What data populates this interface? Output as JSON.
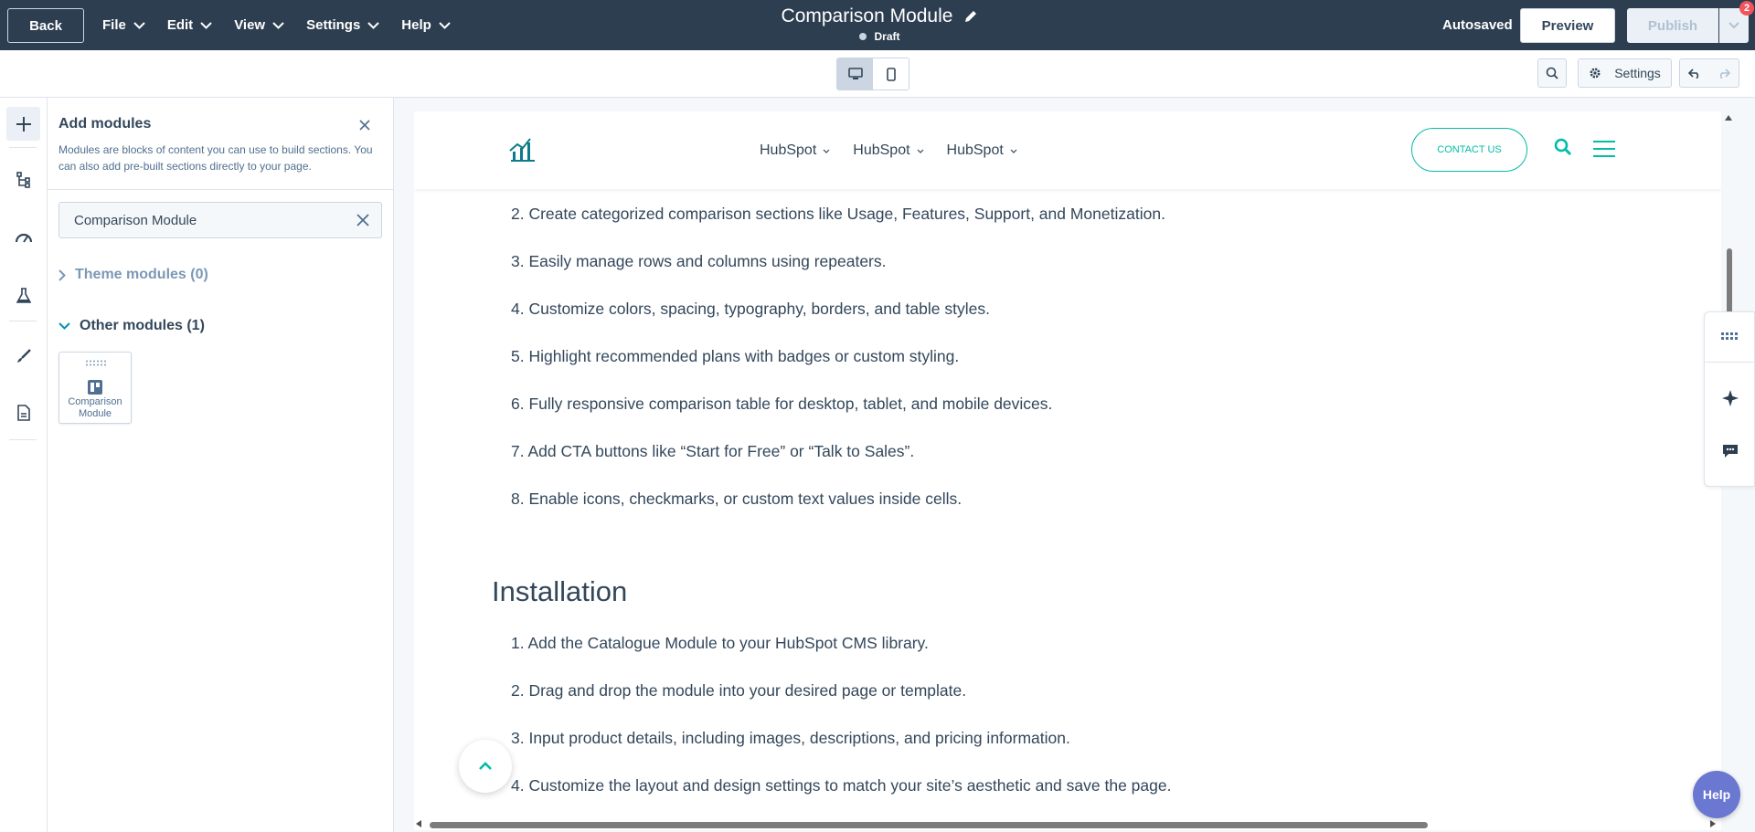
{
  "topbar": {
    "back_label": "Back",
    "menus": [
      "File",
      "Edit",
      "View",
      "Settings",
      "Help"
    ],
    "doc_title": "Comparison Module",
    "status": "Draft",
    "autosaved": "Autosaved",
    "preview_label": "Preview",
    "publish_label": "Publish",
    "notification_count": "2"
  },
  "toolbar": {
    "settings_label": "Settings",
    "active_device": "desktop"
  },
  "panel": {
    "title": "Add modules",
    "description": "Modules are blocks of content you can use to build sections. You can also add pre-built sections directly to your page.",
    "search_value": "Comparison Module",
    "theme_group": "Theme modules (0)",
    "other_group": "Other modules (1)",
    "module_card_label": "Comparison Module"
  },
  "site_header": {
    "nav": [
      "HubSpot",
      "HubSpot",
      "HubSpot"
    ],
    "contact_label": "CONTACT US"
  },
  "content": {
    "features": [
      "2. Create categorized comparison sections like Usage, Features, Support, and Monetization.",
      "3. Easily manage rows and columns using repeaters.",
      "4. Customize colors, spacing, typography, borders, and table styles.",
      "5. Highlight recommended plans with badges or custom styling.",
      "6. Fully responsive comparison table for desktop, tablet, and mobile devices.",
      "7. Add CTA buttons like “Start for Free” or “Talk to Sales”.",
      "8. Enable icons, checkmarks, or custom text values inside cells."
    ],
    "installation_heading": "Installation",
    "installation_steps": [
      "1. Add the Catalogue Module to your HubSpot CMS library.",
      "2. Drag and drop the module into your desired page or template.",
      "3. Input product details, including images, descriptions, and pricing information.",
      "4. Customize the layout and design settings to match your site’s aesthetic and save the page."
    ]
  },
  "help_label": "Help",
  "colors": {
    "topbar": "#2d3e50",
    "accent": "#00bda5",
    "help": "#6a78d1",
    "badge": "#f2545b"
  }
}
